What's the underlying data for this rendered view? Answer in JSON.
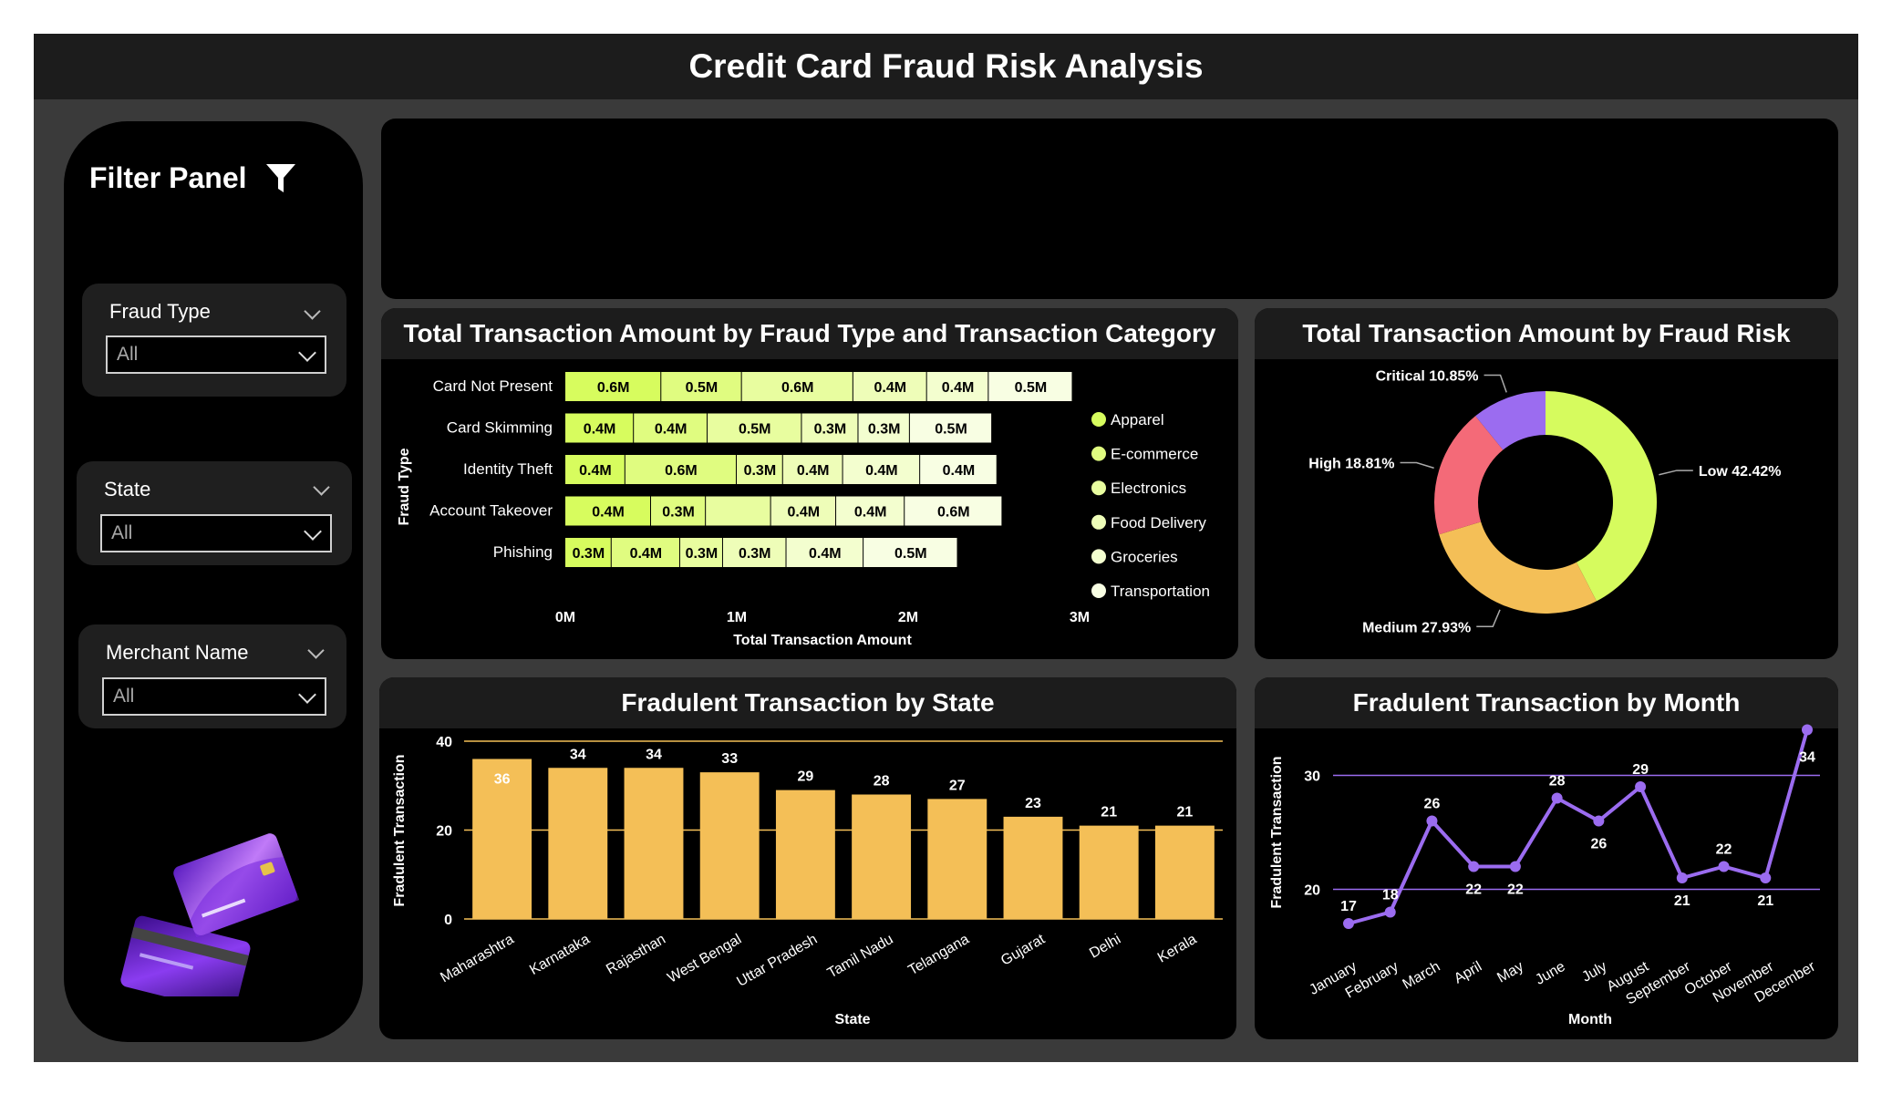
{
  "header": {
    "title": "Credit Card Fraud Risk Analysis"
  },
  "filter_panel": {
    "title": "Filter Panel",
    "slicers": [
      {
        "label": "Fraud Type",
        "value": "All"
      },
      {
        "label": "State",
        "value": "All"
      },
      {
        "label": "Merchant Name",
        "value": "All"
      }
    ]
  },
  "colors": {
    "background": "#3a3a3a",
    "panel": "#000000",
    "panel_header": "#1c1c1c",
    "bar_orange": "#f4bf57",
    "line_purple": "#9b6cf0",
    "donut_low": "#d6fb5e",
    "donut_medium": "#f4bf57",
    "donut_high": "#f46a78",
    "donut_critical": "#9b6cf0"
  },
  "chart_data": [
    {
      "type": "bar",
      "orientation": "horizontal-stacked",
      "title": "Total Transaction Amount by Fraud Type and Transaction Category",
      "xlabel": "Total Transaction Amount",
      "ylabel": "Fraud Type",
      "xlim": [
        0,
        3
      ],
      "xticks": [
        "0M",
        "1M",
        "2M",
        "3M"
      ],
      "categories": [
        "Card Not Present",
        "Card Skimming",
        "Identity Theft",
        "Account Takeover",
        "Phishing"
      ],
      "series": [
        {
          "name": "Apparel",
          "color": "#d7fc5e",
          "values": [
            0.56,
            0.4,
            0.35,
            0.5,
            0.27
          ],
          "labels": [
            "0.6M",
            "0.4M",
            "0.4M",
            "0.4M",
            "0.3M"
          ]
        },
        {
          "name": "E-commerce",
          "color": "#e0fc80",
          "values": [
            0.47,
            0.43,
            0.65,
            0.32,
            0.4
          ],
          "labels": [
            "0.5M",
            "0.4M",
            "0.6M",
            "0.3M",
            "0.4M"
          ]
        },
        {
          "name": "Electronics",
          "color": "#e8fd9f",
          "values": [
            0.65,
            0.55,
            0.27,
            0.38,
            0.25
          ],
          "labels": [
            "0.6M",
            "0.5M",
            "0.3M",
            "",
            "0.3M"
          ]
        },
        {
          "name": "Food Delivery",
          "color": "#eefdb8",
          "values": [
            0.43,
            0.33,
            0.35,
            0.38,
            0.37
          ],
          "labels": [
            "0.4M",
            "0.3M",
            "0.4M",
            "0.4M",
            "0.3M"
          ]
        },
        {
          "name": "Groceries",
          "color": "#f3fecf",
          "values": [
            0.36,
            0.3,
            0.45,
            0.4,
            0.45
          ],
          "labels": [
            "0.4M",
            "0.3M",
            "0.4M",
            "0.4M",
            "0.4M"
          ]
        },
        {
          "name": "Transportation",
          "color": "#f8fee3",
          "values": [
            0.49,
            0.48,
            0.45,
            0.57,
            0.55
          ],
          "labels": [
            "0.5M",
            "0.5M",
            "0.4M",
            "0.6M",
            "0.5M"
          ]
        }
      ]
    },
    {
      "type": "pie",
      "title": "Total Transaction Amount by Fraud Risk",
      "slices": [
        {
          "name": "Low",
          "value": 42.42,
          "label": "Low 42.42%",
          "color": "#d6fb5e"
        },
        {
          "name": "Medium",
          "value": 27.93,
          "label": "Medium 27.93%",
          "color": "#f4bf57"
        },
        {
          "name": "High",
          "value": 18.81,
          "label": "High 18.81%",
          "color": "#f46a78"
        },
        {
          "name": "Critical",
          "value": 10.85,
          "label": "Critical 10.85%",
          "color": "#9b6cf0"
        }
      ]
    },
    {
      "type": "bar",
      "title": "Fradulent Transaction by State",
      "xlabel": "State",
      "ylabel": "Fradulent Transaction",
      "ylim": [
        0,
        40
      ],
      "yticks": [
        0,
        20,
        40
      ],
      "grid": true,
      "categories": [
        "Maharashtra",
        "Karnataka",
        "Rajasthan",
        "West Bengal",
        "Uttar Pradesh",
        "Tamil Nadu",
        "Telangana",
        "Gujarat",
        "Delhi",
        "Kerala"
      ],
      "values": [
        36,
        34,
        34,
        33,
        29,
        28,
        27,
        23,
        21,
        21
      ]
    },
    {
      "type": "line",
      "title": "Fradulent Transaction by Month",
      "xlabel": "Month",
      "ylabel": "Fradulent Transaction",
      "ylim": [
        15,
        35
      ],
      "yticks": [
        20,
        30
      ],
      "grid": true,
      "categories": [
        "January",
        "February",
        "March",
        "April",
        "May",
        "June",
        "July",
        "August",
        "September",
        "October",
        "November",
        "December"
      ],
      "values": [
        17,
        18,
        26,
        22,
        22,
        28,
        26,
        29,
        21,
        22,
        21,
        34
      ]
    }
  ]
}
